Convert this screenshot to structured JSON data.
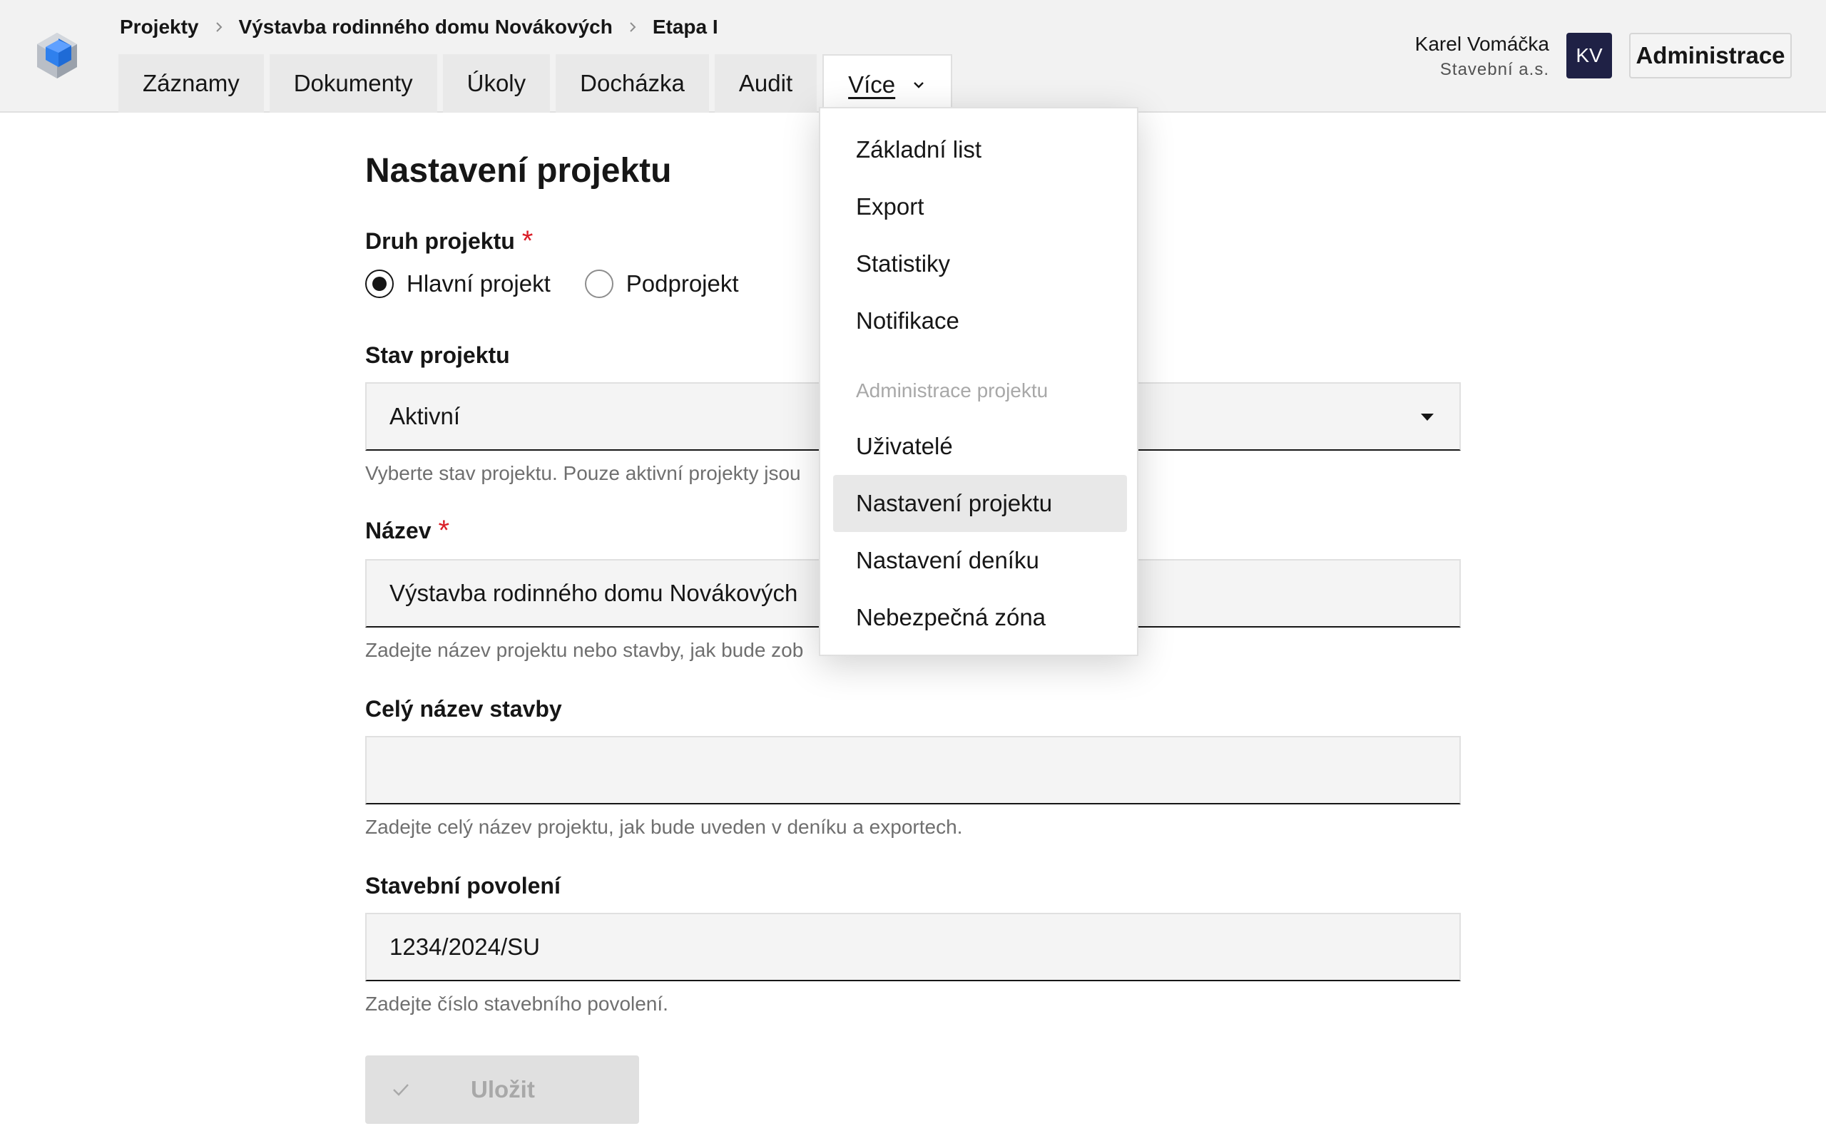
{
  "breadcrumb": {
    "items": [
      "Projekty",
      "Výstavba rodinného domu Novákových",
      "Etapa I"
    ]
  },
  "tabs": [
    "Záznamy",
    "Dokumenty",
    "Úkoly",
    "Docházka",
    "Audit",
    "Více"
  ],
  "user": {
    "name": "Karel Vomáčka",
    "company": "Stavební a.s.",
    "initials": "KV",
    "admin_label": "Administrace"
  },
  "menu": {
    "items_top": [
      "Základní list",
      "Export",
      "Statistiky",
      "Notifikace"
    ],
    "section_label": "Administrace projektu",
    "items_admin": [
      "Uživatelé",
      "Nastavení projektu",
      "Nastavení deníku",
      "Nebezpečná zóna"
    ],
    "active_item": "Nastavení projektu"
  },
  "form": {
    "title": "Nastavení projektu",
    "druh": {
      "label": "Druh projektu",
      "options": [
        "Hlavní projekt",
        "Podprojekt"
      ],
      "selected": "Hlavní projekt"
    },
    "stav": {
      "label": "Stav projektu",
      "value": "Aktivní",
      "helper": "Vyberte stav projektu. Pouze aktivní projekty jsou"
    },
    "nazev": {
      "label": "Název",
      "value": "Výstavba rodinného domu Novákových",
      "helper": "Zadejte název projektu nebo stavby, jak bude zob"
    },
    "cely_nazev": {
      "label": "Celý název stavby",
      "value": "",
      "helper": "Zadejte celý název projektu, jak bude uveden v deníku a exportech."
    },
    "povoleni": {
      "label": "Stavební povolení",
      "value": "1234/2024/SU",
      "helper": "Zadejte číslo stavebního povolení."
    },
    "save_label": "Uložit"
  },
  "colors": {
    "avatar_bg": "#1f2145",
    "required": "#da1e28",
    "logo_blue": "#1f6bd6"
  }
}
